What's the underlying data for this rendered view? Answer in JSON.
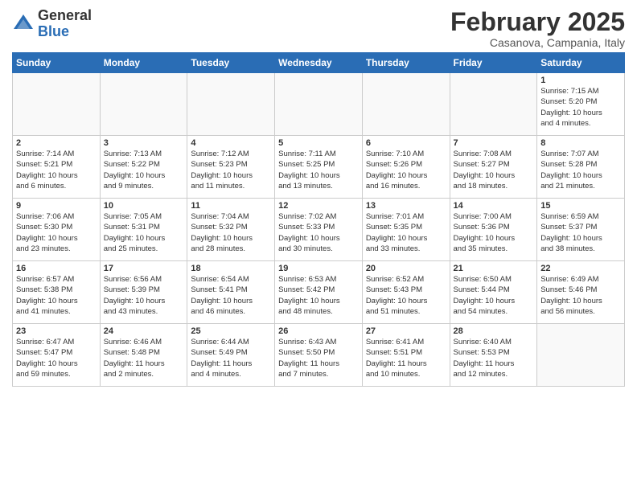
{
  "logo": {
    "general": "General",
    "blue": "Blue"
  },
  "title": "February 2025",
  "subtitle": "Casanova, Campania, Italy",
  "headers": [
    "Sunday",
    "Monday",
    "Tuesday",
    "Wednesday",
    "Thursday",
    "Friday",
    "Saturday"
  ],
  "weeks": [
    [
      {
        "num": "",
        "info": ""
      },
      {
        "num": "",
        "info": ""
      },
      {
        "num": "",
        "info": ""
      },
      {
        "num": "",
        "info": ""
      },
      {
        "num": "",
        "info": ""
      },
      {
        "num": "",
        "info": ""
      },
      {
        "num": "1",
        "info": "Sunrise: 7:15 AM\nSunset: 5:20 PM\nDaylight: 10 hours\nand 4 minutes."
      }
    ],
    [
      {
        "num": "2",
        "info": "Sunrise: 7:14 AM\nSunset: 5:21 PM\nDaylight: 10 hours\nand 6 minutes."
      },
      {
        "num": "3",
        "info": "Sunrise: 7:13 AM\nSunset: 5:22 PM\nDaylight: 10 hours\nand 9 minutes."
      },
      {
        "num": "4",
        "info": "Sunrise: 7:12 AM\nSunset: 5:23 PM\nDaylight: 10 hours\nand 11 minutes."
      },
      {
        "num": "5",
        "info": "Sunrise: 7:11 AM\nSunset: 5:25 PM\nDaylight: 10 hours\nand 13 minutes."
      },
      {
        "num": "6",
        "info": "Sunrise: 7:10 AM\nSunset: 5:26 PM\nDaylight: 10 hours\nand 16 minutes."
      },
      {
        "num": "7",
        "info": "Sunrise: 7:08 AM\nSunset: 5:27 PM\nDaylight: 10 hours\nand 18 minutes."
      },
      {
        "num": "8",
        "info": "Sunrise: 7:07 AM\nSunset: 5:28 PM\nDaylight: 10 hours\nand 21 minutes."
      }
    ],
    [
      {
        "num": "9",
        "info": "Sunrise: 7:06 AM\nSunset: 5:30 PM\nDaylight: 10 hours\nand 23 minutes."
      },
      {
        "num": "10",
        "info": "Sunrise: 7:05 AM\nSunset: 5:31 PM\nDaylight: 10 hours\nand 25 minutes."
      },
      {
        "num": "11",
        "info": "Sunrise: 7:04 AM\nSunset: 5:32 PM\nDaylight: 10 hours\nand 28 minutes."
      },
      {
        "num": "12",
        "info": "Sunrise: 7:02 AM\nSunset: 5:33 PM\nDaylight: 10 hours\nand 30 minutes."
      },
      {
        "num": "13",
        "info": "Sunrise: 7:01 AM\nSunset: 5:35 PM\nDaylight: 10 hours\nand 33 minutes."
      },
      {
        "num": "14",
        "info": "Sunrise: 7:00 AM\nSunset: 5:36 PM\nDaylight: 10 hours\nand 35 minutes."
      },
      {
        "num": "15",
        "info": "Sunrise: 6:59 AM\nSunset: 5:37 PM\nDaylight: 10 hours\nand 38 minutes."
      }
    ],
    [
      {
        "num": "16",
        "info": "Sunrise: 6:57 AM\nSunset: 5:38 PM\nDaylight: 10 hours\nand 41 minutes."
      },
      {
        "num": "17",
        "info": "Sunrise: 6:56 AM\nSunset: 5:39 PM\nDaylight: 10 hours\nand 43 minutes."
      },
      {
        "num": "18",
        "info": "Sunrise: 6:54 AM\nSunset: 5:41 PM\nDaylight: 10 hours\nand 46 minutes."
      },
      {
        "num": "19",
        "info": "Sunrise: 6:53 AM\nSunset: 5:42 PM\nDaylight: 10 hours\nand 48 minutes."
      },
      {
        "num": "20",
        "info": "Sunrise: 6:52 AM\nSunset: 5:43 PM\nDaylight: 10 hours\nand 51 minutes."
      },
      {
        "num": "21",
        "info": "Sunrise: 6:50 AM\nSunset: 5:44 PM\nDaylight: 10 hours\nand 54 minutes."
      },
      {
        "num": "22",
        "info": "Sunrise: 6:49 AM\nSunset: 5:46 PM\nDaylight: 10 hours\nand 56 minutes."
      }
    ],
    [
      {
        "num": "23",
        "info": "Sunrise: 6:47 AM\nSunset: 5:47 PM\nDaylight: 10 hours\nand 59 minutes."
      },
      {
        "num": "24",
        "info": "Sunrise: 6:46 AM\nSunset: 5:48 PM\nDaylight: 11 hours\nand 2 minutes."
      },
      {
        "num": "25",
        "info": "Sunrise: 6:44 AM\nSunset: 5:49 PM\nDaylight: 11 hours\nand 4 minutes."
      },
      {
        "num": "26",
        "info": "Sunrise: 6:43 AM\nSunset: 5:50 PM\nDaylight: 11 hours\nand 7 minutes."
      },
      {
        "num": "27",
        "info": "Sunrise: 6:41 AM\nSunset: 5:51 PM\nDaylight: 11 hours\nand 10 minutes."
      },
      {
        "num": "28",
        "info": "Sunrise: 6:40 AM\nSunset: 5:53 PM\nDaylight: 11 hours\nand 12 minutes."
      },
      {
        "num": "",
        "info": ""
      }
    ]
  ]
}
